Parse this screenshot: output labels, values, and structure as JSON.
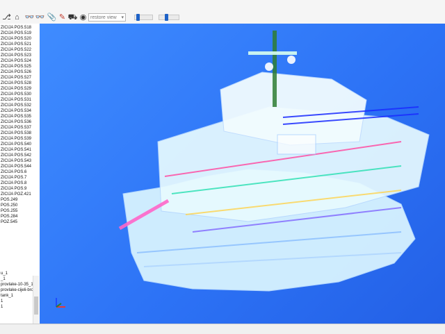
{
  "toolbar": {
    "restore_view": "restore view",
    "slider1_label": "",
    "slider2_label": ""
  },
  "tree": {
    "items": [
      "ZICIJA POS.518",
      "ZICIJA POS.519",
      "ZICIJA POS.520",
      "ZICIJA POS.521",
      "ZICIJA POS.522",
      "ZICIJA POS.523",
      "ZICIJA POS.524",
      "ZICIJA POS.525",
      "ZICIJA POS.526",
      "ZICIJA POS.527",
      "ZICIJA POS.528",
      "ZICIJA POS.529",
      "ZICIJA POS.530",
      "ZICIJA POS.531",
      "ZICIJA POS.532",
      "ZICIJA POS.534",
      "ZICIJA POS.535",
      "ZICIJA POS.536",
      "ZICIJA POS.537",
      "ZICIJA POS.538",
      "ZICIJA POS.539",
      "ZICIJA POS.540",
      "ZICIJA POS.541",
      "ZICIJA POS.542",
      "ZICIJA POS.543",
      "ZICIJA POS.544",
      "ZICIJA POS.6",
      "ZICIJA POS.7",
      "ZICIJA POS.8",
      "ZICIJA POS.9",
      "ZICIJA POZ.421",
      "POS.249",
      "POS.250",
      "POS.255",
      "POS.284",
      "POZ.545",
      "u_1",
      "_1",
      "provlake-10-35_1",
      "provlake-cijeli-bro",
      "tank_1",
      "1",
      "1"
    ]
  }
}
